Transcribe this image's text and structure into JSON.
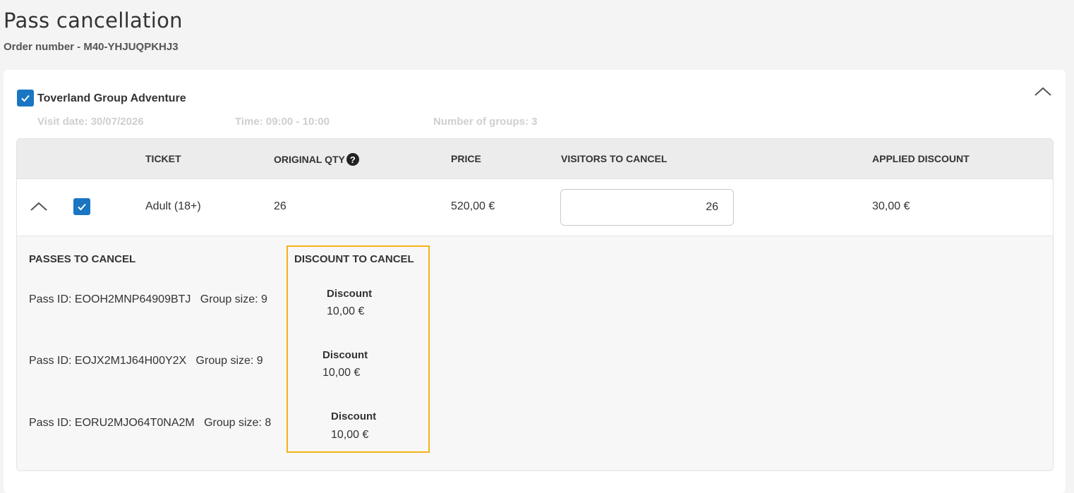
{
  "header": {
    "title": "Pass cancellation",
    "order_number": "Order number - M40-YHJUQPKHJ3"
  },
  "product": {
    "name": "Toverland Group Adventure",
    "checked": true,
    "visit_date": "Visit date: 30/07/2026",
    "time": "Time: 09:00 - 10:00",
    "groups": "Number of groups: 3"
  },
  "table": {
    "headers": {
      "ticket": "TICKET",
      "original_qty": "ORIGINAL QTY",
      "price": "PRICE",
      "visitors_to_cancel": "VISITORS TO CANCEL",
      "applied_discount": "APPLIED DISCOUNT"
    },
    "help_icon": "?",
    "row": {
      "ticket": "Adult (18+)",
      "original_qty": "26",
      "price": "520,00 €",
      "visitors_to_cancel": "26",
      "applied_discount": "30,00 €",
      "checked": true
    }
  },
  "passes": {
    "title": "PASSES TO CANCEL",
    "items": [
      "Pass ID: EOOH2MNP64909BTJ   Group size: 9",
      "Pass ID: EOJX2M1J64H00Y2X   Group size: 9",
      "Pass ID: EORU2MJO64T0NA2M   Group size: 8"
    ]
  },
  "discounts": {
    "title": "DISCOUNT TO CANCEL",
    "highlight_color": "#f5b21a",
    "items": [
      {
        "label": "Discount",
        "value": "10,00 €"
      },
      {
        "label": "Discount",
        "value": "10,00 €"
      },
      {
        "label": "Discount",
        "value": "10,00 €"
      }
    ]
  },
  "colors": {
    "accent": "#1a76c2"
  }
}
